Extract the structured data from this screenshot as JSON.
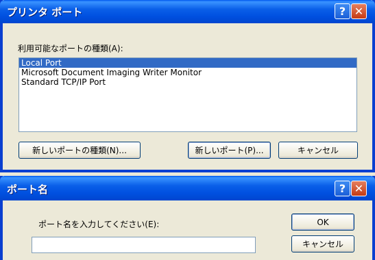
{
  "dialog1": {
    "title": "プリンタ ポート",
    "help_label": "?",
    "close_label": "✕",
    "list_label": "利用可能なポートの種類(A):",
    "ports": [
      "Local Port",
      "Microsoft Document Imaging Writer Monitor",
      "Standard TCP/IP Port"
    ],
    "selected_index": 0,
    "new_port_type_button": "新しいポートの種類(N)...",
    "new_port_button": "新しいポート(P)...",
    "cancel_button": "キャンセル"
  },
  "dialog2": {
    "title": "ポート名",
    "help_label": "?",
    "close_label": "✕",
    "prompt": "ポート名を入力してください(E):",
    "port_name_value": "",
    "ok_button": "OK",
    "cancel_button": "キャンセル"
  },
  "colors": {
    "titlebar": "#0054e3",
    "selection": "#316ac5",
    "dialog_bg": "#ece9d8",
    "close_button": "#d4542c"
  }
}
